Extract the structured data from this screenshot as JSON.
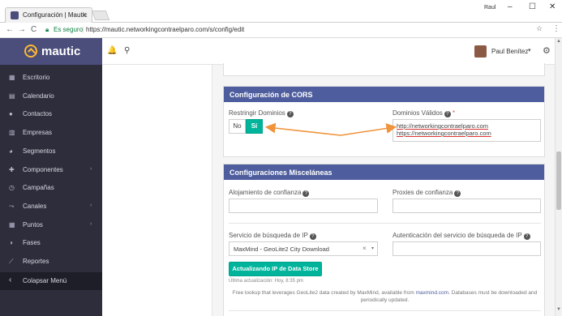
{
  "browser": {
    "tab_title": "Configuración | Mautic",
    "tab_close": "×",
    "chrome_user": "Raul",
    "window_controls": [
      "–",
      "☐",
      "✕"
    ],
    "nav": [
      "←",
      "→",
      "C"
    ],
    "secure_label": "Es seguro",
    "url": "https://mautic.networkingcontraelparo.com/s/config/edit",
    "star": "☆",
    "menu": "⋮"
  },
  "sidebar": {
    "brand": "mautic",
    "items": [
      {
        "icon": "dashboard-icon",
        "glyph": "▦",
        "label": "Escritorio",
        "caret": false
      },
      {
        "icon": "calendar-icon",
        "glyph": "▤",
        "label": "Calendario",
        "caret": false
      },
      {
        "icon": "user-icon",
        "glyph": "●",
        "label": "Contactos",
        "caret": false
      },
      {
        "icon": "building-icon",
        "glyph": "▥",
        "label": "Empresas",
        "caret": false
      },
      {
        "icon": "pie-chart-icon",
        "glyph": "◕",
        "label": "Segmentos",
        "caret": false
      },
      {
        "icon": "puzzle-icon",
        "glyph": "✚",
        "label": "Componentes",
        "caret": true
      },
      {
        "icon": "clock-icon",
        "glyph": "◷",
        "label": "Campañas",
        "caret": false
      },
      {
        "icon": "share-icon",
        "glyph": "⤳",
        "label": "Canales",
        "caret": true
      },
      {
        "icon": "calculator-icon",
        "glyph": "▦",
        "label": "Puntos",
        "caret": true
      },
      {
        "icon": "tachometer-icon",
        "glyph": "◑",
        "label": "Fases",
        "caret": false
      },
      {
        "icon": "line-chart-icon",
        "glyph": "⟋",
        "label": "Reportes",
        "caret": false
      }
    ],
    "collapse_label": "Colapsar Menú",
    "collapse_glyph": "‹",
    "caret_glyph": "›"
  },
  "header": {
    "bell": "🔔",
    "search": "⚲",
    "user_name": "Paul Benítez",
    "user_caret": "▾",
    "gear": "⚙"
  },
  "cors": {
    "title": "Configuración de CORS",
    "restrict_label": "Restringir Dominios",
    "no_label": "No",
    "si_label": "Sí",
    "domains_label": "Dominios Válidos",
    "required_mark": "*",
    "domains": [
      "http://networkingcontraelparo.com",
      "https://networkingcontraelparo.com"
    ]
  },
  "misc": {
    "title": "Configuraciones Misceláneas",
    "trusted_hosts_label": "Alojamiento de confianza",
    "trusted_proxies_label": "Proxies de confianza",
    "ip_service_label": "Servicio de búsqueda de IP",
    "ip_service_value": "MaxMind - GeoLite2 City Download",
    "ip_auth_label": "Autenticación del servicio de búsqueda de IP",
    "update_button": "Actualizando IP de Data Store",
    "last_update": "Última actualización: Hoy, 8:35 pm",
    "info_text_1": "Free lookup that leverages GeoLite2 data created by MaxMind, available from ",
    "info_link": "maxmind.com",
    "info_text_2": ". Databases must be downloaded and periodically updated.",
    "clear_glyph": "×",
    "caret_glyph": "▾"
  },
  "help_glyph": "?",
  "colors": {
    "brand": "#4b4d7a",
    "sidebar": "#2d2d3b",
    "panel_header": "#4e5d9d",
    "accent": "#00b49c",
    "annotation_arrow": "#f0933a"
  }
}
